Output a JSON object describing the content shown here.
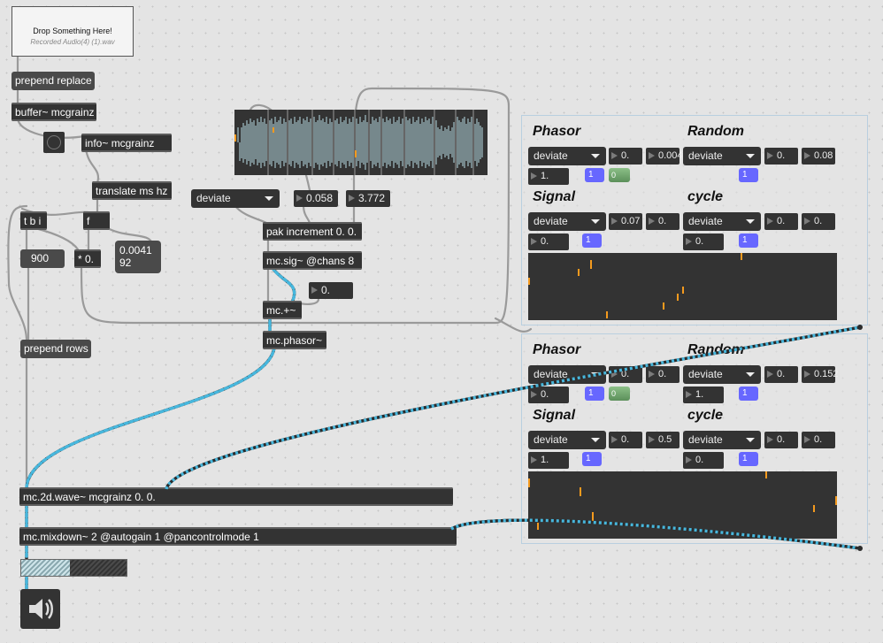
{
  "dropzone": {
    "title": "Drop Something Here!",
    "file": "Recorded Audio(4) (1).wav"
  },
  "objects": {
    "prepend_replace": "prepend replace",
    "buffer": "buffer~ mcgrainz",
    "info": "info~ mcgrainz",
    "translate": "translate ms hz",
    "tbi": "t b i",
    "f": "f",
    "mult": "* 0.",
    "pak": "pak increment 0. 0.",
    "mcsig": "mc.sig~ @chans 8",
    "mcplus": "mc.+~",
    "mcphasor": "mc.phasor~",
    "prepend_rows": "prepend rows",
    "wave2d": "mc.2d.wave~ mcgrainz 0. 0.",
    "mixdown": "mc.mixdown~ 2 @autogain 1 @pancontrolmode 1"
  },
  "messages": {
    "nine_hundred": "900",
    "readout_line1": "0.0041",
    "readout_line2": "92"
  },
  "numbers": {
    "increment_lo": "0.058",
    "increment_hi": "3.772",
    "offset": "0."
  },
  "menus": {
    "deviate": "deviate"
  },
  "panels": [
    {
      "labels": {
        "phasor": "Phasor",
        "random": "Random",
        "signal": "Signal",
        "cycle": "cycle"
      },
      "phasor": {
        "menu": "deviate",
        "n1": "0.",
        "n2": "0.004",
        "n3": "1.",
        "toggle": "1",
        "toggle2": "0"
      },
      "random": {
        "menu": "deviate",
        "n1": "0.",
        "n2": "0.08",
        "toggle": "1"
      },
      "signal": {
        "menu": "deviate",
        "n1": "0.07",
        "n2": "0.",
        "n3": "0.",
        "toggle": "1"
      },
      "cycle": {
        "menu": "deviate",
        "n1": "0.",
        "n2": "0.",
        "n3": "0.",
        "toggle": "1"
      }
    },
    {
      "labels": {
        "phasor": "Phasor",
        "random": "Random",
        "signal": "Signal",
        "cycle": "cycle"
      },
      "phasor": {
        "menu": "deviate",
        "n1": "0.",
        "n2": "0.",
        "n3": "0.",
        "toggle": "1",
        "toggle2": "0"
      },
      "random": {
        "menu": "deviate",
        "n1": "0.",
        "n2": "0.152",
        "toggle": "1",
        "n3": "1."
      },
      "signal": {
        "menu": "deviate",
        "n1": "0.",
        "n2": "0.5",
        "n3": "1.",
        "toggle": "1"
      },
      "cycle": {
        "menu": "deviate",
        "n1": "0.",
        "n2": "0.",
        "n3": "0.",
        "toggle": "1"
      }
    }
  ],
  "meter": {
    "level": 0.46
  },
  "colors": {
    "accent_toggle": "#6767ff",
    "scope_tick": "#f49a1e",
    "patch_cord_mc": "#47b7dd"
  }
}
